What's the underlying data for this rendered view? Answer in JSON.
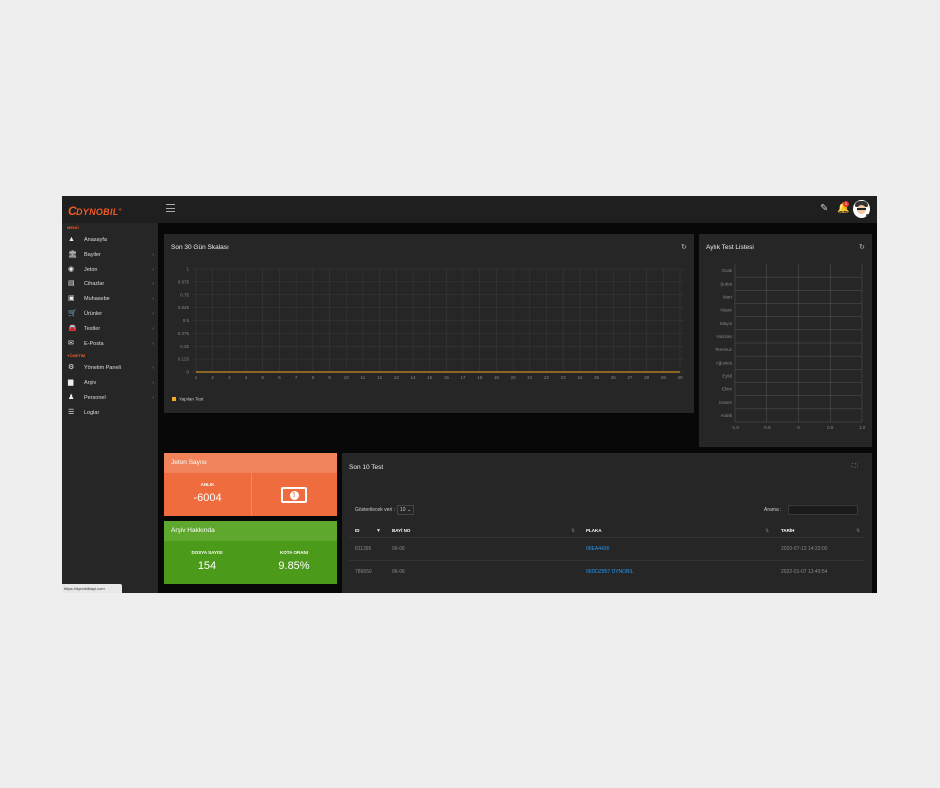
{
  "brand": {
    "name": "DYNOBIL",
    "mark": "C",
    "reg": "®"
  },
  "topbar": {
    "notification_count": "1",
    "edit_icon": "edit-icon",
    "bell_icon": "bell-icon"
  },
  "sidebar": {
    "section1": "MENÜ",
    "section2": "YÖNETİM",
    "items1": [
      {
        "label": "Anasayfa",
        "icon": "▲",
        "arrow": ""
      },
      {
        "label": "Bayiler",
        "icon": "🏛",
        "arrow": "‹"
      },
      {
        "label": "Jeton",
        "icon": "◉",
        "arrow": "‹"
      },
      {
        "label": "Cihazlar",
        "icon": "▤",
        "arrow": "‹"
      },
      {
        "label": "Muhasebe",
        "icon": "▣",
        "arrow": "‹"
      },
      {
        "label": "Ürünler",
        "icon": "🛒",
        "arrow": "‹"
      },
      {
        "label": "Testler",
        "icon": "🚘",
        "arrow": "‹"
      },
      {
        "label": "E-Posta",
        "icon": "✉",
        "arrow": "‹"
      }
    ],
    "items2": [
      {
        "label": "Yönetim Paneli",
        "icon": "⚙",
        "arrow": "‹"
      },
      {
        "label": "Arşiv",
        "icon": "▆",
        "arrow": "‹"
      },
      {
        "label": "Personel",
        "icon": "♟",
        "arrow": "‹"
      },
      {
        "label": "Loglar",
        "icon": "☰",
        "arrow": ""
      }
    ]
  },
  "status_url": "https://dynobilbayi.com",
  "chart1": {
    "title": "Son 30 Gün Skalası",
    "chart_data": {
      "type": "line",
      "x": [
        1,
        2,
        3,
        4,
        5,
        6,
        7,
        8,
        9,
        10,
        11,
        12,
        13,
        14,
        15,
        16,
        17,
        18,
        19,
        20,
        21,
        22,
        23,
        24,
        25,
        26,
        27,
        28,
        29,
        30
      ],
      "yticks": [
        "1",
        "0.875",
        "0.75",
        "0.625",
        "0.5",
        "0.375",
        "0.25",
        "0.125",
        "0"
      ],
      "ylim": [
        0,
        1
      ],
      "series": [
        {
          "name": "Yapılan Test",
          "color": "#f5a623",
          "values": [
            0,
            0,
            0,
            0,
            0,
            0,
            0,
            0,
            0,
            0,
            0,
            0,
            0,
            0,
            0,
            0,
            0,
            0,
            0,
            0,
            0,
            0,
            0,
            0,
            0,
            0,
            0,
            0,
            0,
            0
          ]
        }
      ],
      "legend": "bottom-left",
      "grid": true
    }
  },
  "chart2": {
    "title": "Aylık Test Listesi",
    "chart_data": {
      "type": "bar",
      "orientation": "horizontal",
      "categories": [
        "Ocak",
        "Şubat",
        "Mart",
        "Nisan",
        "Mayıs",
        "Haziran",
        "Temmuz",
        "Ağustos",
        "Eylül",
        "Ekim",
        "Kasım",
        "Aralık"
      ],
      "xticks": [
        "-1.0",
        "-0.5",
        "0",
        "0.5",
        "1.0"
      ],
      "xlim": [
        -1,
        1
      ],
      "values": [
        0,
        0,
        0,
        0,
        0,
        0,
        0,
        0,
        0,
        0,
        0,
        0
      ],
      "grid": true
    }
  },
  "jeton": {
    "title": "Jeton Sayısı",
    "label": "ANLIK",
    "value": "-6004",
    "icon": "money-icon",
    "coin": "!",
    "color": "#ee6c3e"
  },
  "arsiv": {
    "title": "Arşiv Hakkında",
    "label1": "DOSYA SAYISI",
    "value1": "154",
    "label2": "KOTA ORANI",
    "value2": "9.85%",
    "color": "#4c9a1a"
  },
  "tests": {
    "title": "Son 10 Test",
    "show_label": "Gösterilecek veri :",
    "show_value": "10",
    "search_label": "Arama :",
    "columns": [
      "ID",
      "BAYİ NO",
      "PLAKA",
      "TARİH"
    ],
    "rows": [
      {
        "id": "811395",
        "bayi": "06-06",
        "plaka": "06EA4436",
        "tarih": "2020-07-13 14:33:00"
      },
      {
        "id": "789650",
        "bayi": "06-06",
        "plaka": "06DDZ857 DYNOBIL",
        "tarih": "2022-01-07 13:49:54"
      }
    ]
  }
}
